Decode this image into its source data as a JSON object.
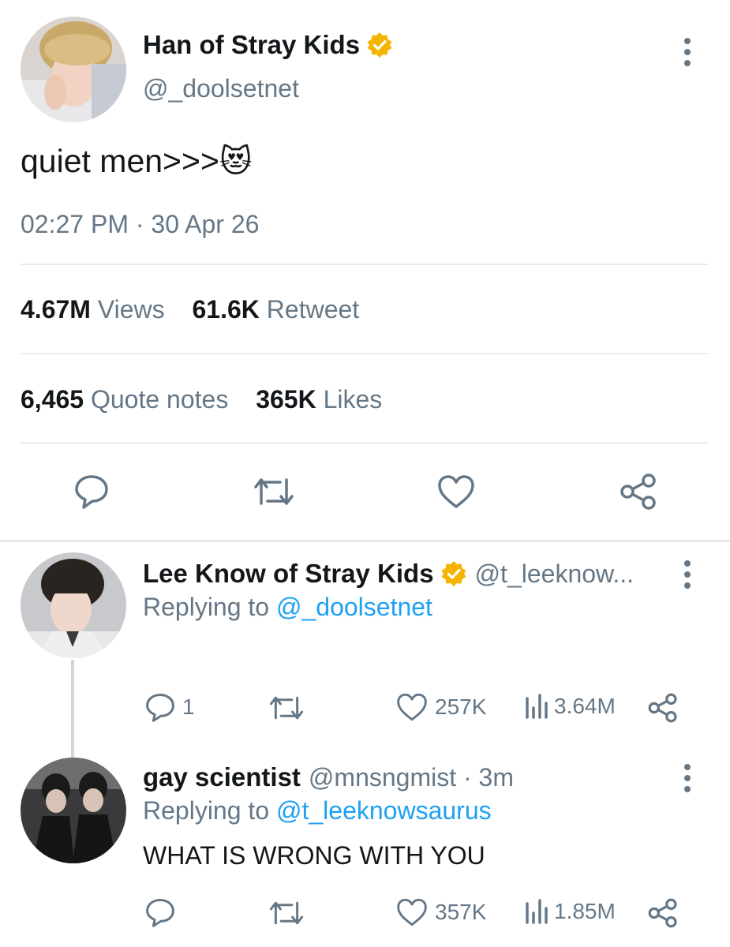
{
  "main_tweet": {
    "display_name": "Han of Stray Kids",
    "handle": "@_doolsetnet",
    "text": "quiet men>>>",
    "emoji": "😻",
    "time": "02:27 PM · 30 Apr 26",
    "stats_row1": [
      {
        "value": "4.67M",
        "label": "Views"
      },
      {
        "value": "61.6K",
        "label": "Retweet"
      }
    ],
    "stats_row2": [
      {
        "value": "6,465",
        "label": "Quote notes"
      },
      {
        "value": "365K",
        "label": "Likes"
      }
    ]
  },
  "reply1": {
    "display_name": "Lee Know of Stray Kids",
    "handle": "@t_leeknow...",
    "replying_prefix": "Replying to",
    "replying_to": "@_doolsetnet",
    "reply_count": "1",
    "like_count": "257K",
    "view_count": "3.64M"
  },
  "reply2": {
    "display_name": "gay scientist",
    "handle_time": "@mnsngmist · 3m",
    "replying_prefix": "Replying to",
    "replying_to": "@t_leeknowsaurus",
    "text": "WHAT IS WRONG WITH YOU",
    "like_count": "357K",
    "view_count": "1.85M"
  },
  "colors": {
    "link": "#1da1f2",
    "muted": "#657786",
    "verified": "#f4b400",
    "divider": "#e6ecf0"
  },
  "icons": [
    "more-vertical-icon",
    "verified-badge-icon",
    "reply-icon",
    "retweet-icon",
    "like-icon",
    "share-icon",
    "views-icon"
  ]
}
